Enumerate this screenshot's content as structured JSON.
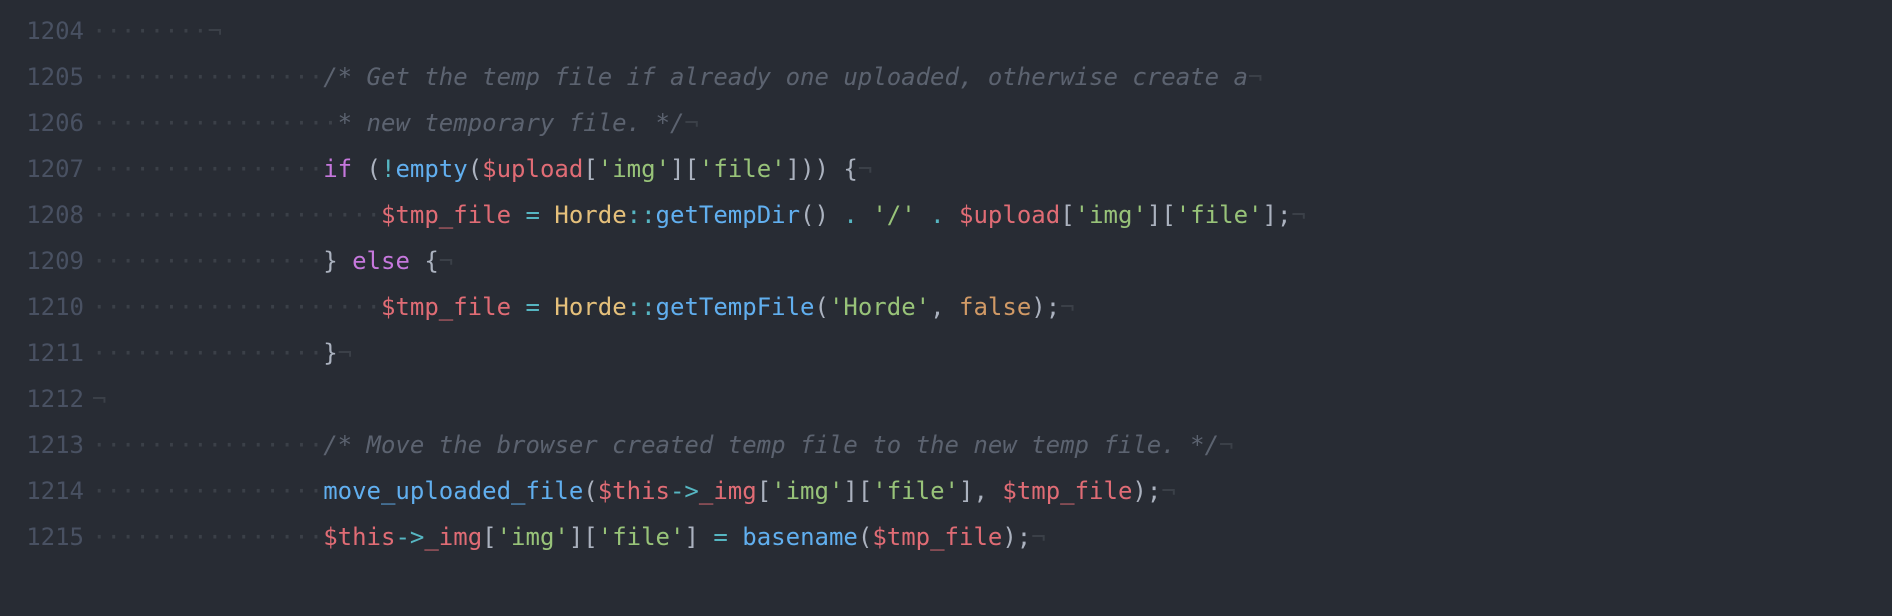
{
  "lines": [
    {
      "num": "1204",
      "ws": "········",
      "tokens": [
        {
          "t": "¬",
          "c": "nl"
        }
      ]
    },
    {
      "num": "1205",
      "ws": "················",
      "tokens": [
        {
          "t": "/* Get the temp file if already one uploaded, otherwise create a",
          "c": "comment"
        },
        {
          "t": "¬",
          "c": "nl"
        }
      ]
    },
    {
      "num": "1206",
      "ws": "·················",
      "tokens": [
        {
          "t": "* new temporary file. */",
          "c": "comment"
        },
        {
          "t": "¬",
          "c": "nl"
        }
      ]
    },
    {
      "num": "1207",
      "ws": "················",
      "tokens": [
        {
          "t": "if",
          "c": "keyword"
        },
        {
          "t": " (",
          "c": "punct"
        },
        {
          "t": "!",
          "c": "op"
        },
        {
          "t": "empty",
          "c": "func"
        },
        {
          "t": "(",
          "c": "punct"
        },
        {
          "t": "$upload",
          "c": "var"
        },
        {
          "t": "[",
          "c": "punct"
        },
        {
          "t": "'img'",
          "c": "string"
        },
        {
          "t": "][",
          "c": "punct"
        },
        {
          "t": "'file'",
          "c": "string"
        },
        {
          "t": "])) {",
          "c": "punct"
        },
        {
          "t": "¬",
          "c": "nl"
        }
      ]
    },
    {
      "num": "1208",
      "ws": "····················",
      "tokens": [
        {
          "t": "$tmp_file",
          "c": "var"
        },
        {
          "t": " ",
          "c": "punct"
        },
        {
          "t": "=",
          "c": "op"
        },
        {
          "t": " ",
          "c": "punct"
        },
        {
          "t": "Horde",
          "c": "class"
        },
        {
          "t": "::",
          "c": "op"
        },
        {
          "t": "getTempDir",
          "c": "func"
        },
        {
          "t": "() ",
          "c": "punct"
        },
        {
          "t": ".",
          "c": "op"
        },
        {
          "t": " ",
          "c": "punct"
        },
        {
          "t": "'/'",
          "c": "string"
        },
        {
          "t": " ",
          "c": "punct"
        },
        {
          "t": ".",
          "c": "op"
        },
        {
          "t": " ",
          "c": "punct"
        },
        {
          "t": "$upload",
          "c": "var"
        },
        {
          "t": "[",
          "c": "punct"
        },
        {
          "t": "'img'",
          "c": "string"
        },
        {
          "t": "][",
          "c": "punct"
        },
        {
          "t": "'file'",
          "c": "string"
        },
        {
          "t": "];",
          "c": "punct"
        },
        {
          "t": "¬",
          "c": "nl"
        }
      ]
    },
    {
      "num": "1209",
      "ws": "················",
      "tokens": [
        {
          "t": "} ",
          "c": "punct"
        },
        {
          "t": "else",
          "c": "keyword"
        },
        {
          "t": " {",
          "c": "punct"
        },
        {
          "t": "¬",
          "c": "nl"
        }
      ]
    },
    {
      "num": "1210",
      "ws": "····················",
      "tokens": [
        {
          "t": "$tmp_file",
          "c": "var"
        },
        {
          "t": " ",
          "c": "punct"
        },
        {
          "t": "=",
          "c": "op"
        },
        {
          "t": " ",
          "c": "punct"
        },
        {
          "t": "Horde",
          "c": "class"
        },
        {
          "t": "::",
          "c": "op"
        },
        {
          "t": "getTempFile",
          "c": "func"
        },
        {
          "t": "(",
          "c": "punct"
        },
        {
          "t": "'Horde'",
          "c": "string"
        },
        {
          "t": ", ",
          "c": "punct"
        },
        {
          "t": "false",
          "c": "const"
        },
        {
          "t": ");",
          "c": "punct"
        },
        {
          "t": "¬",
          "c": "nl"
        }
      ]
    },
    {
      "num": "1211",
      "ws": "················",
      "tokens": [
        {
          "t": "}",
          "c": "punct"
        },
        {
          "t": "¬",
          "c": "nl"
        }
      ]
    },
    {
      "num": "1212",
      "ws": "",
      "tokens": [
        {
          "t": "¬",
          "c": "nl"
        }
      ]
    },
    {
      "num": "1213",
      "ws": "················",
      "tokens": [
        {
          "t": "/* Move the browser created temp file to the new temp file. */",
          "c": "comment"
        },
        {
          "t": "¬",
          "c": "nl"
        }
      ]
    },
    {
      "num": "1214",
      "ws": "················",
      "tokens": [
        {
          "t": "move_uploaded_file",
          "c": "func"
        },
        {
          "t": "(",
          "c": "punct"
        },
        {
          "t": "$this",
          "c": "var"
        },
        {
          "t": "->",
          "c": "op"
        },
        {
          "t": "_img",
          "c": "var"
        },
        {
          "t": "[",
          "c": "punct"
        },
        {
          "t": "'img'",
          "c": "string"
        },
        {
          "t": "][",
          "c": "punct"
        },
        {
          "t": "'file'",
          "c": "string"
        },
        {
          "t": "], ",
          "c": "punct"
        },
        {
          "t": "$tmp_file",
          "c": "var"
        },
        {
          "t": ");",
          "c": "punct"
        },
        {
          "t": "¬",
          "c": "nl"
        }
      ]
    },
    {
      "num": "1215",
      "ws": "················",
      "tokens": [
        {
          "t": "$this",
          "c": "var"
        },
        {
          "t": "->",
          "c": "op"
        },
        {
          "t": "_img",
          "c": "var"
        },
        {
          "t": "[",
          "c": "punct"
        },
        {
          "t": "'img'",
          "c": "string"
        },
        {
          "t": "][",
          "c": "punct"
        },
        {
          "t": "'file'",
          "c": "string"
        },
        {
          "t": "] ",
          "c": "punct"
        },
        {
          "t": "=",
          "c": "op"
        },
        {
          "t": " ",
          "c": "punct"
        },
        {
          "t": "basename",
          "c": "func"
        },
        {
          "t": "(",
          "c": "punct"
        },
        {
          "t": "$tmp_file",
          "c": "var"
        },
        {
          "t": ");",
          "c": "punct"
        },
        {
          "t": "¬",
          "c": "nl"
        }
      ]
    }
  ]
}
